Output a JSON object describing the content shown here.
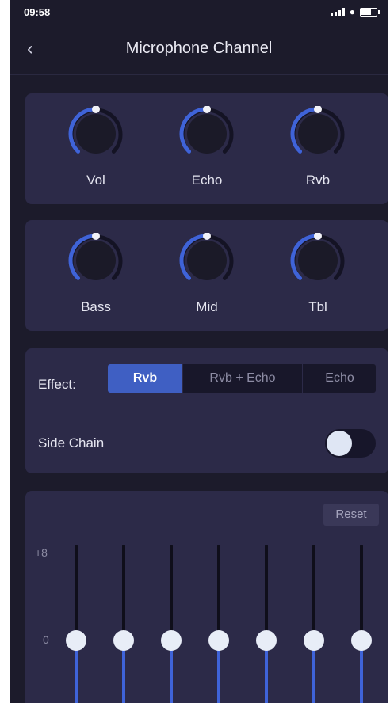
{
  "status": {
    "time": "09:58"
  },
  "header": {
    "title": "Microphone Channel"
  },
  "knobs_row1": [
    {
      "label": "Vol",
      "value": 0.5
    },
    {
      "label": "Echo",
      "value": 0.5
    },
    {
      "label": "Rvb",
      "value": 0.5
    }
  ],
  "knobs_row2": [
    {
      "label": "Bass",
      "value": 0.5
    },
    {
      "label": "Mid",
      "value": 0.5
    },
    {
      "label": "Tbl",
      "value": 0.5
    }
  ],
  "effect": {
    "label": "Effect:",
    "options": [
      "Rvb",
      "Rvb + Echo",
      "Echo"
    ],
    "selected": "Rvb"
  },
  "side_chain": {
    "label": "Side Chain",
    "enabled": false
  },
  "eq": {
    "reset_label": "Reset",
    "max_label": "+8",
    "zero_label": "0",
    "bands": [
      0,
      0,
      0,
      0,
      0,
      0,
      0
    ]
  },
  "colors": {
    "background": "#1c1b2b",
    "card": "#2c2a48",
    "accent": "#3f5fc3",
    "knob_arc": "#3f63d8"
  }
}
